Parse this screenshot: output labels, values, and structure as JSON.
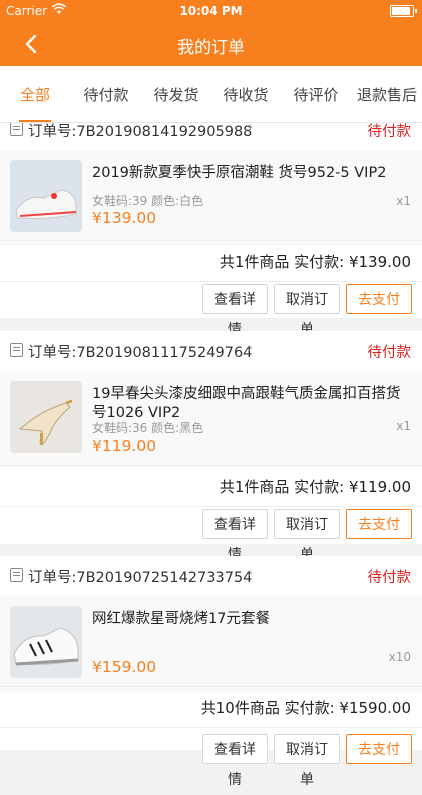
{
  "status_bar": {
    "carrier": "Carrier",
    "time": "10:04 PM",
    "battery_level": 0.9
  },
  "header": {
    "title": "我的订单"
  },
  "tabs": [
    {
      "label": "全部",
      "active": true
    },
    {
      "label": "待付款",
      "active": false
    },
    {
      "label": "待发货",
      "active": false
    },
    {
      "label": "待收货",
      "active": false
    },
    {
      "label": "待评价",
      "active": false
    },
    {
      "label": "退款售后",
      "active": false
    }
  ],
  "orders": [
    {
      "order_no": "订单号:7B20190814192905988",
      "status": "待付款",
      "product_name": "2019新款夏季快手原宿潮鞋 货号952-5 VIP2",
      "spec": "女鞋码:39 颜色:白色",
      "price": "¥139.00",
      "qty": "x1",
      "summary": "共1件商品 实付款: ¥139.00",
      "buttons": {
        "detail": "查看详情",
        "cancel": "取消订单",
        "pay": "去支付"
      }
    },
    {
      "order_no": "订单号:7B20190811175249764",
      "status": "待付款",
      "product_name": "19早春尖头漆皮细跟中高跟鞋气质金属扣百搭货号1026 VIP2",
      "spec": "女鞋码:36 颜色:黑色",
      "price": "¥119.00",
      "qty": "x1",
      "summary": "共1件商品 实付款: ¥119.00",
      "buttons": {
        "detail": "查看详情",
        "cancel": "取消订单",
        "pay": "去支付"
      }
    },
    {
      "order_no": "订单号:7B20190725142733754",
      "status": "待付款",
      "product_name": "网红爆款星哥烧烤17元套餐",
      "spec": "",
      "price": "¥159.00",
      "qty": "x10",
      "summary": "共10件商品 实付款: ¥1590.00",
      "buttons": {
        "detail": "查看详情",
        "cancel": "取消订单",
        "pay": "去支付"
      }
    }
  ],
  "colors": {
    "accent": "#f77f1e",
    "status_red": "#e02020"
  }
}
